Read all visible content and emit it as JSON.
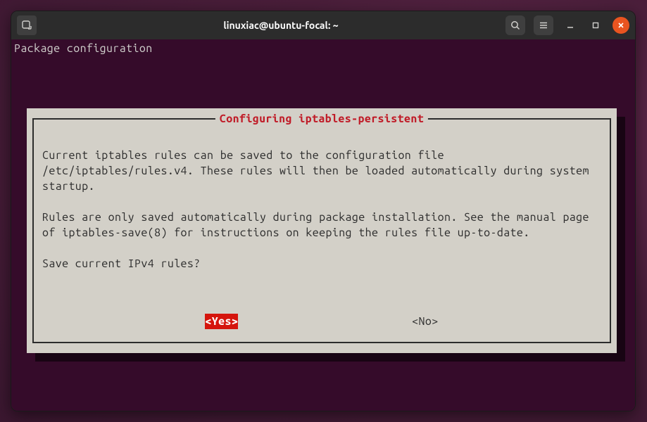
{
  "window": {
    "title": "linuxiac@ubuntu-focal: ~"
  },
  "header": {
    "heading": "Package configuration"
  },
  "dialog": {
    "title": " Configuring iptables-persistent ",
    "paragraph1": "Current iptables rules can be saved to the configuration file /etc/iptables/rules.v4. These rules will then be loaded automatically during system startup.",
    "paragraph2": "Rules are only saved automatically during package installation. See the manual page of iptables-save(8) for instructions on keeping the rules file up-to-date.",
    "question": "Save current IPv4 rules?",
    "yes_label": "<Yes>",
    "no_label": "<No>",
    "selected": "yes"
  },
  "colors": {
    "accent": "#e95420",
    "dialog_title": "#c01c28",
    "selected_bg": "#d5150d"
  }
}
